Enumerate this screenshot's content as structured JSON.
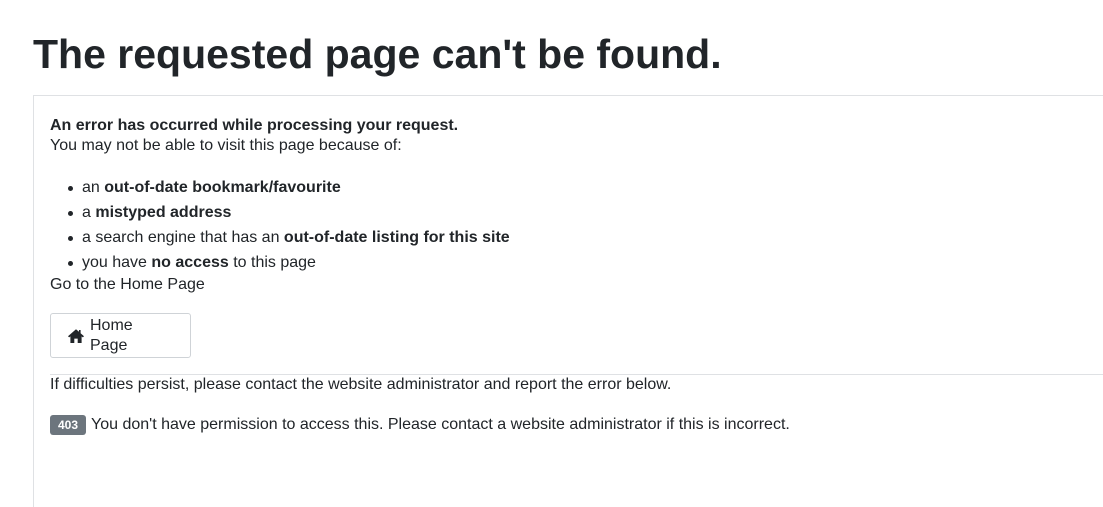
{
  "page_title": "The requested page can't be found.",
  "error_card": {
    "lead": "An error has occurred while processing your request.",
    "reasons_intro": "You may not be able to visit this page because of:",
    "reasons": [
      {
        "prefix": "an ",
        "bold": "out-of-date bookmark/favourite",
        "suffix": ""
      },
      {
        "prefix": "a ",
        "bold": "mistyped address",
        "suffix": ""
      },
      {
        "prefix": "a search engine that has an ",
        "bold": "out-of-date listing for this site",
        "suffix": ""
      },
      {
        "prefix": "you have ",
        "bold": "no access",
        "suffix": " to this page"
      }
    ],
    "home_intro": "Go to the Home Page",
    "home_button": {
      "icon": "home-icon",
      "label": "Home Page"
    },
    "persist_text": "If difficulties persist, please contact the website administrator and report the error below.",
    "error_code": "403",
    "error_message": "You don't have permission to access this. Please contact a website administrator if this is incorrect."
  },
  "colors": {
    "text": "#212529",
    "badge_bg": "#6c757d",
    "border": "#dfe1e4"
  }
}
